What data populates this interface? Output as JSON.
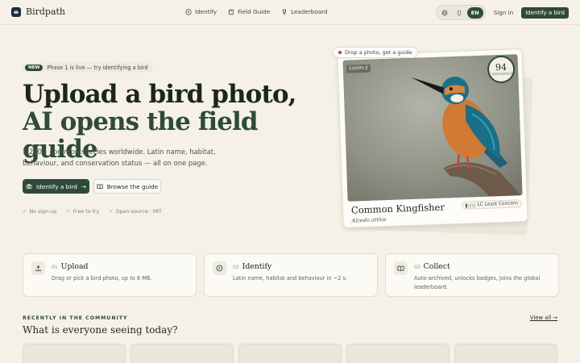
{
  "nav": {
    "brand": "Birdpath",
    "links": [
      "Identify",
      "Field Guide",
      "Leaderboard"
    ],
    "lang": "EN",
    "signin": "Sign in",
    "cta": "Identify a bird"
  },
  "hero": {
    "badge": "NEW",
    "badge_text": "Phase 1 is live — try identifying a bird",
    "title_line1": "Upload a bird photo,",
    "title_line2": "AI opens the field guide",
    "subtitle": "1,200+ common species worldwide. Latin name, habitat, behaviour, and conservation status — all on one page.",
    "primary_button": "Identify a bird",
    "primary_arrow": "→",
    "secondary_button": "Browse the guide",
    "checks": [
      "No sign-up",
      "Free to try",
      "Open-source · MIT"
    ],
    "check_mark": "✓"
  },
  "card": {
    "drop_chip": "Drop a photo, get a guide",
    "sample": "SAMPLE",
    "confidence": "94",
    "confidence_label": "CONFIDENCE",
    "species": "Common Kingfisher",
    "latin": "Alcedo atthis",
    "status": "LC Least Concern"
  },
  "steps": [
    {
      "num": "01",
      "title": "Upload",
      "desc": "Drag or pick a bird photo, up to 8 MB.",
      "icon": "upload-icon"
    },
    {
      "num": "02",
      "title": "Identify",
      "desc": "Latin name, habitat and behaviour in ~2 s.",
      "icon": "compass-icon"
    },
    {
      "num": "03",
      "title": "Collect",
      "desc": "Auto-archived, unlocks badges, joins the global leaderboard.",
      "icon": "book-icon"
    }
  ],
  "community": {
    "eyebrow": "RECENTLY IN THE COMMUNITY",
    "title": "What is everyone seeing today?",
    "view_all": "View all →"
  },
  "colors": {
    "background": "#f5f1e8",
    "accent": "#2f4a3a",
    "text": "#1d2520"
  }
}
